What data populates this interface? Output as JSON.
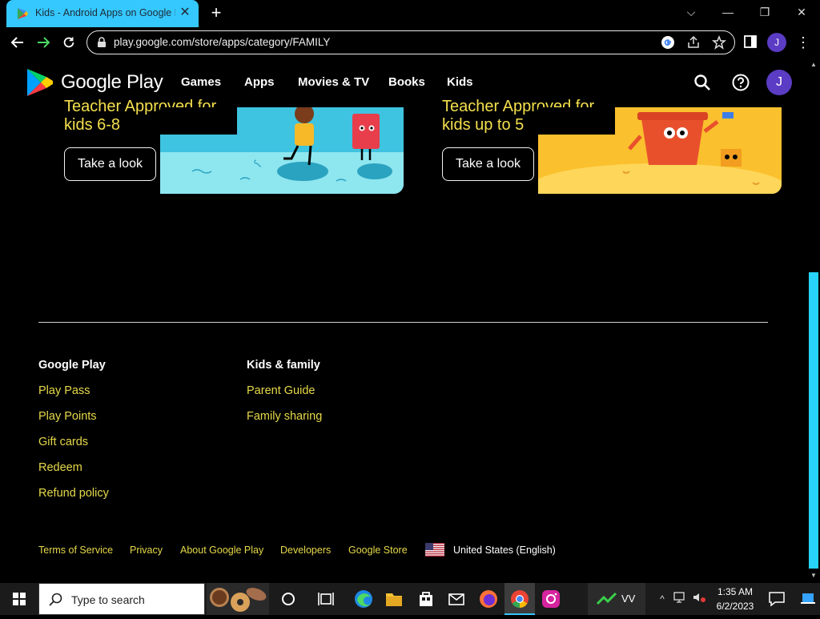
{
  "browser": {
    "tab_title": "Kids - Android Apps on Google Play",
    "url": "play.google.com/store/apps/category/FAMILY",
    "profile_initial": "J"
  },
  "header": {
    "brand": "Google Play",
    "nav": [
      "Games",
      "Apps",
      "Movies & TV",
      "Books",
      "Kids"
    ],
    "avatar_initial": "J"
  },
  "cards": [
    {
      "line1": "Teacher Approved for",
      "line2": "kids 6-8",
      "button": "Take a look"
    },
    {
      "line1": "Teacher Approved for",
      "line2": "kids up to 5",
      "button": "Take a look"
    }
  ],
  "footer": {
    "col1_head": "Google Play",
    "col1_links": [
      "Play Pass",
      "Play Points",
      "Gift cards",
      "Redeem",
      "Refund policy"
    ],
    "col2_head": "Kids & family",
    "col2_links": [
      "Parent Guide",
      "Family sharing"
    ],
    "bottom_links": [
      "Terms of Service",
      "Privacy",
      "About Google Play",
      "Developers",
      "Google Store"
    ],
    "locale": "United States (English)"
  },
  "taskbar": {
    "search_placeholder": "Type to search",
    "vv_label": "VV",
    "time": "1:35 AM",
    "date": "6/2/2023"
  },
  "colors": {
    "accent_cyan": "#35c8ff",
    "link_yellow": "#e6d94a",
    "avatar_purple": "#5b3cc4"
  }
}
